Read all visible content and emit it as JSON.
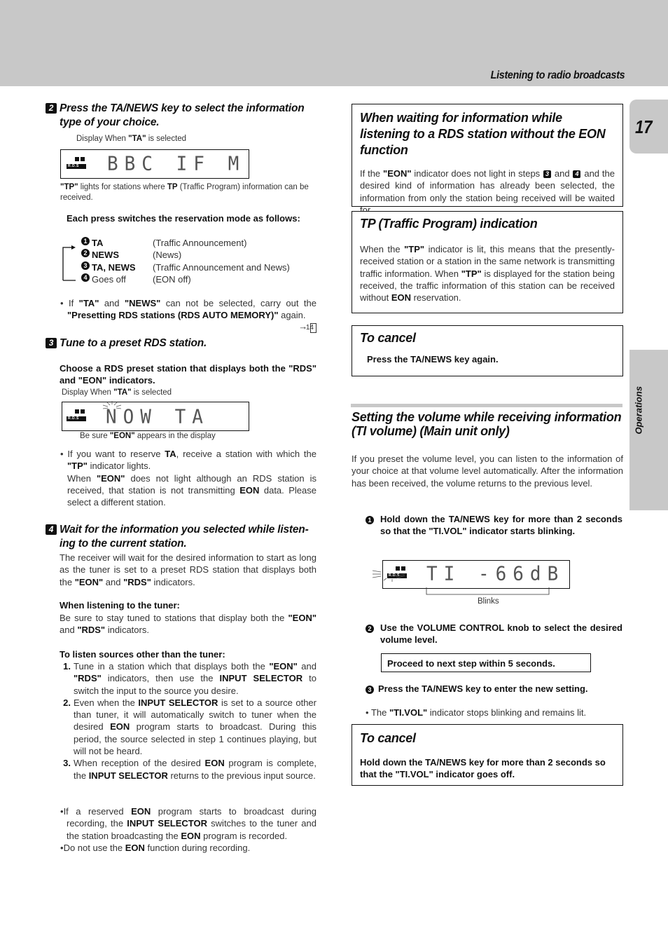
{
  "header": {
    "section_title": "Listening to radio broadcasts",
    "page_number": "17",
    "side_tab": "Operations"
  },
  "left": {
    "step2": {
      "badge": "2",
      "title_line1": "Press the TA/NEWS key to select the information",
      "title_line2": "type of your choice.",
      "display_caption_pre": "Display When ",
      "display_caption_bold": "\"TA\"",
      "display_caption_post": " is selected",
      "lcd_text": "BBC IF M",
      "rds_label": "R.D.S",
      "tp_note_bold1": "\"TP\"",
      "tp_note_mid": " lights for stations where ",
      "tp_note_bold2": "TP",
      "tp_note_post": " (Traffic Program) information can be received.",
      "modes_intro": "Each press switches the reservation mode as follows:",
      "modes": [
        {
          "num": "1",
          "key": "TA",
          "desc": "(Traffic Announcement)",
          "bold": true
        },
        {
          "num": "2",
          "key": "NEWS",
          "desc": "(News)",
          "bold": true
        },
        {
          "num": "3",
          "key": "TA, NEWS",
          "desc": "(Traffic Announcement and News)",
          "bold": true
        },
        {
          "num": "4",
          "key": "Goes off",
          "desc": "(EON off)",
          "bold": false
        }
      ],
      "bullet_pre": "If ",
      "bullet_b1": "\"TA\"",
      "bullet_and": " and ",
      "bullet_b2": "\"NEWS\"",
      "bullet_mid": " can not be selected, carry out the ",
      "bullet_b3": "\"Presetting RDS stations (RDS AUTO MEMORY)\"",
      "bullet_post": " again.",
      "page_ref": "14"
    },
    "step3": {
      "badge": "3",
      "title": "Tune to a preset RDS station.",
      "instruction": "Choose a RDS preset station that displays both the \"RDS\" and \"EON\" indicators.",
      "display_caption_pre": "Display When ",
      "display_caption_bold": "\"TA\"",
      "display_caption_post": " is selected",
      "lcd_text": "NOW TA",
      "rds_label": "R.D.S",
      "eon_note_pre": "Be sure ",
      "eon_note_bold": "\"EON\"",
      "eon_note_post": " appears in the display",
      "bullet_p1_pre": "If you want to reserve ",
      "bullet_p1_b1": "TA",
      "bullet_p1_mid": ", receive a station with which the ",
      "bullet_p1_b2": "\"TP\"",
      "bullet_p1_post": " indicator lights.",
      "bullet_p2_pre": "When ",
      "bullet_p2_b1": "\"EON\"",
      "bullet_p2_mid": " does not light although an RDS station is received, that station is not transmitting ",
      "bullet_p2_b2": "EON",
      "bullet_p2_post": " data. Please select a different station."
    },
    "step4": {
      "badge": "4",
      "title_line1": "Wait for the information you selected while listen-",
      "title_line2": "ing to the current station.",
      "desc_pre": "The receiver will wait for the desired information to start as long as the tuner is set to a preset RDS station that displays both the ",
      "desc_b1": "\"EON\"",
      "desc_and": " and ",
      "desc_b2": "\"RDS\"",
      "desc_post": " indicators.",
      "tuner_heading": "When listening to the tuner:",
      "tuner_pre": "Be sure to stay tuned to stations that display both the ",
      "tuner_b1": "\"EON\"",
      "tuner_and": " and ",
      "tuner_b2": "\"RDS\"",
      "tuner_post": " indicators.",
      "other_heading": "To listen sources other than the tuner:",
      "other_items": [
        {
          "n": "1.",
          "parts": [
            [
              "Tune in a station which that displays both the ",
              false
            ],
            [
              "\"EON\"",
              true
            ],
            [
              " and ",
              false
            ],
            [
              "\"RDS\"",
              true
            ],
            [
              " indicators, then use the ",
              false
            ],
            [
              "INPUT SELECTOR",
              true
            ],
            [
              " to switch the input to the source you desire.",
              false
            ]
          ]
        },
        {
          "n": "2.",
          "parts": [
            [
              "Even when the ",
              false
            ],
            [
              "INPUT SELECTOR",
              true
            ],
            [
              " is set to a source other than tuner, it will automatically switch to tuner when the desired ",
              false
            ],
            [
              "EON",
              true
            ],
            [
              " program starts to broadcast. During this period, the source selected in step 1 continues playing, but will not be heard.",
              false
            ]
          ]
        },
        {
          "n": "3.",
          "parts": [
            [
              "When reception of the desired ",
              false
            ],
            [
              "EON",
              true
            ],
            [
              " program is complete, the ",
              false
            ],
            [
              "INPUT SELECTOR",
              true
            ],
            [
              " returns to the previous input source.",
              false
            ]
          ]
        }
      ],
      "notes": [
        [
          [
            "If a reserved ",
            false
          ],
          [
            "EON",
            true
          ],
          [
            " program starts to broadcast during recording, the ",
            false
          ],
          [
            "INPUT SELECTOR",
            true
          ],
          [
            " switches to the tuner and the station broadcasting the ",
            false
          ],
          [
            "EON",
            true
          ],
          [
            " program is recorded.",
            false
          ]
        ],
        [
          [
            "Do not use the ",
            false
          ],
          [
            "EON",
            true
          ],
          [
            " function during recording.",
            false
          ]
        ]
      ]
    }
  },
  "right": {
    "eon_box": {
      "title": "When waiting for information while listening to a RDS station without the EON  function",
      "text_pre": "If the ",
      "text_b1": "\"EON\"",
      "text_mid1": " indicator does not light in steps ",
      "step_a": "3",
      "text_and": " and ",
      "step_b": "4",
      "text_post": " and the desired kind of information has already been selected, the information from only the station being received will be waited for."
    },
    "tp_box": {
      "title": "TP (Traffic Program) indication",
      "text_pre": "When the ",
      "text_b1": "\"TP\"",
      "text_mid1": " indicator is lit, this means that the presently-received station or a station in the same network is transmitting traffic information. When ",
      "text_b2": "\"TP\"",
      "text_mid2": " is displayed for the station being received, the traffic information of this station can be received without ",
      "text_b3": "EON",
      "text_post": " reservation."
    },
    "cancel_box1": {
      "title": "To cancel",
      "text": "Press the TA/NEWS key again."
    },
    "ti_volume": {
      "title": "Setting the volume while receiving information (TI volume) (Main unit only)",
      "intro": "If you preset the volume level, you can listen to the information of your choice at that volume level automatically. After the information has been received, the volume returns to the previous level.",
      "step1_num": "1",
      "step1": "Hold down the TA/NEWS key for more than 2 seconds so that the \"TI.VOL\" indicator starts blinking.",
      "lcd_text": "TI -66dB",
      "rds_label": "R.D.S",
      "blinks_label": "Blinks",
      "step2_num": "2",
      "step2": "Use the VOLUME CONTROL knob to select the desired volume level.",
      "proceed_note": "Proceed to next step within 5 seconds.",
      "step3_num": "3",
      "step3": "Press the TA/NEWS key to enter the new setting.",
      "bullet_pre": "The ",
      "bullet_bold": "\"TI.VOL\"",
      "bullet_post": " indicator stops blinking and remains lit."
    },
    "cancel_box2": {
      "title": "To cancel",
      "text": "Hold down the TA/NEWS key for more than 2 seconds so that the \"TI.VOL\" indicator goes off."
    }
  }
}
